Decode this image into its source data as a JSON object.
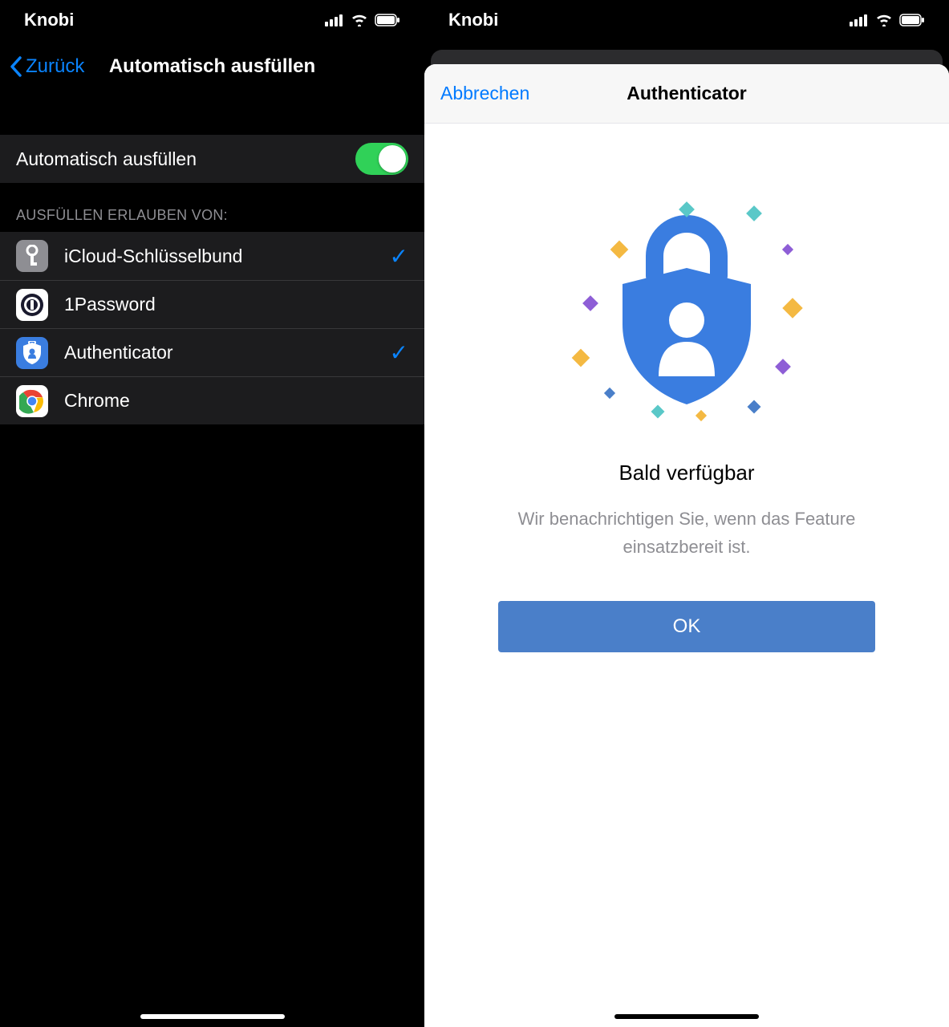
{
  "status": {
    "carrier": "Knobi"
  },
  "left": {
    "back_label": "Zurück",
    "title": "Automatisch ausfüllen",
    "toggle_label": "Automatisch ausfüllen",
    "section_header": "AUSFÜLLEN ERLAUBEN VON:",
    "providers": [
      {
        "label": "iCloud-Schlüsselbund",
        "checked": true
      },
      {
        "label": "1Password",
        "checked": false
      },
      {
        "label": "Authenticator",
        "checked": true
      },
      {
        "label": "Chrome",
        "checked": false
      }
    ]
  },
  "right": {
    "cancel_label": "Abbrechen",
    "title": "Authenticator",
    "headline": "Bald verfügbar",
    "body": "Wir benachrichtigen Sie, wenn das Feature einsatzbereit ist.",
    "ok_label": "OK"
  }
}
